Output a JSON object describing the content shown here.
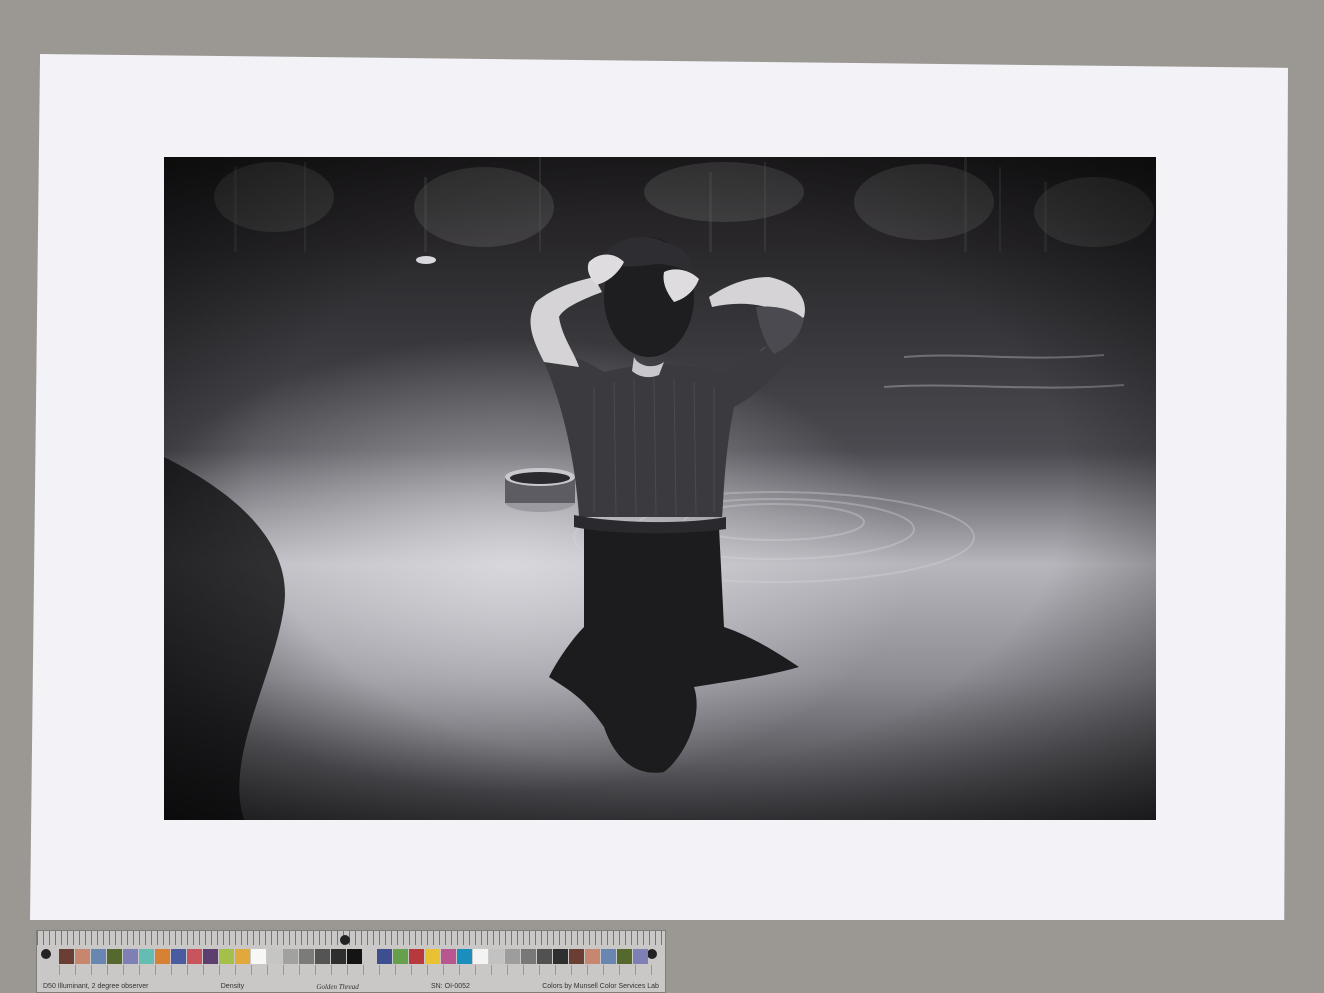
{
  "photograph": {
    "subject": "woman-wading-in-lake"
  },
  "color_target": {
    "patch_colors": [
      "#6b3e33",
      "#c7866f",
      "#6986b1",
      "#55682e",
      "#7d7fb5",
      "#63bdb2",
      "#d78134",
      "#4b5ba0",
      "#c8545e",
      "#5d3f6f",
      "#a5c04a",
      "#e1a83b",
      "#f7f7f5",
      "#c5c5c3",
      "#a1a1a0",
      "#7b7b7a",
      "#545454",
      "#2e2e2e",
      "#141414"
    ],
    "patch_colors_right": [
      "#3d4f8f",
      "#67a04d",
      "#b8393d",
      "#e8c232",
      "#b7568f",
      "#1a8ebc",
      "#f3f3f3",
      "#c2c2c2",
      "#9d9d9d",
      "#787878",
      "#515151",
      "#2f2f2f",
      "#6b3e33",
      "#c7866f",
      "#6986b1",
      "#55682e",
      "#7d7fb5"
    ],
    "labels": {
      "left": "D50 Illuminant, 2 degree observer",
      "middle": "Density",
      "brand": "Golden Thread",
      "serial": "SN: OI-0052",
      "right": "Colors by Munsell Color Services Lab"
    }
  }
}
